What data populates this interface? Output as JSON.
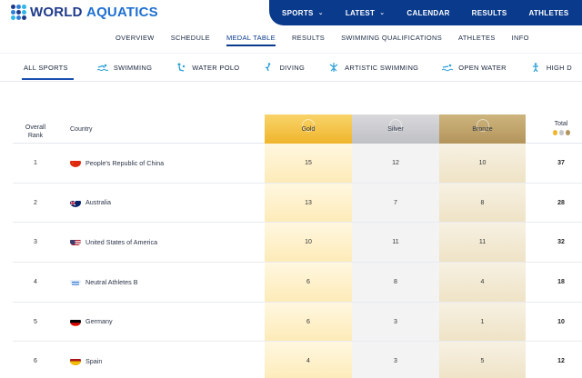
{
  "brand": {
    "name_bold": "WORLD",
    "name_light": "AQUATICS"
  },
  "topnav": [
    {
      "label": "SPORTS",
      "has_dropdown": true
    },
    {
      "label": "LATEST",
      "has_dropdown": true
    },
    {
      "label": "CALENDAR",
      "has_dropdown": false
    },
    {
      "label": "RESULTS",
      "has_dropdown": false
    },
    {
      "label": "ATHLETES",
      "has_dropdown": false
    }
  ],
  "subnav": [
    {
      "label": "OVERVIEW"
    },
    {
      "label": "SCHEDULE"
    },
    {
      "label": "MEDAL TABLE",
      "active": true
    },
    {
      "label": "RESULTS"
    },
    {
      "label": "SWIMMING QUALIFICATIONS"
    },
    {
      "label": "ATHLETES"
    },
    {
      "label": "INFO"
    }
  ],
  "sport_tabs": [
    {
      "label": "ALL SPORTS",
      "icon": "none",
      "active": true
    },
    {
      "label": "SWIMMING",
      "icon": "swimming-icon"
    },
    {
      "label": "WATER POLO",
      "icon": "water-polo-icon"
    },
    {
      "label": "DIVING",
      "icon": "diving-icon"
    },
    {
      "label": "ARTISTIC SWIMMING",
      "icon": "artistic-swimming-icon"
    },
    {
      "label": "OPEN WATER",
      "icon": "open-water-icon"
    },
    {
      "label": "HIGH D",
      "icon": "high-diving-icon"
    }
  ],
  "table": {
    "headers": {
      "rank_line1": "Overall",
      "rank_line2": "Rank",
      "country": "Country",
      "gold": "Gold",
      "silver": "Silver",
      "bronze": "Bronze",
      "total": "Total"
    },
    "rows": [
      {
        "rank": "1",
        "country": "People's Republic of China",
        "flag": "china",
        "gold": "15",
        "silver": "12",
        "bronze": "10",
        "total": "37"
      },
      {
        "rank": "2",
        "country": "Australia",
        "flag": "australia",
        "gold": "13",
        "silver": "7",
        "bronze": "8",
        "total": "28"
      },
      {
        "rank": "3",
        "country": "United States of America",
        "flag": "usa",
        "gold": "10",
        "silver": "11",
        "bronze": "11",
        "total": "32"
      },
      {
        "rank": "4",
        "country": "Neutral Athletes B",
        "flag": "neutral",
        "gold": "6",
        "silver": "8",
        "bronze": "4",
        "total": "18"
      },
      {
        "rank": "5",
        "country": "Germany",
        "flag": "germany",
        "gold": "6",
        "silver": "3",
        "bronze": "1",
        "total": "10"
      },
      {
        "rank": "6",
        "country": "Spain",
        "flag": "spain",
        "gold": "4",
        "silver": "3",
        "bronze": "5",
        "total": "12"
      }
    ]
  },
  "colors": {
    "brand_navy": "#0a3a8c",
    "accent_blue": "#1a4fb0",
    "gold": "#f0b52c",
    "silver": "#c4c5c9",
    "bronze": "#b3955b"
  }
}
